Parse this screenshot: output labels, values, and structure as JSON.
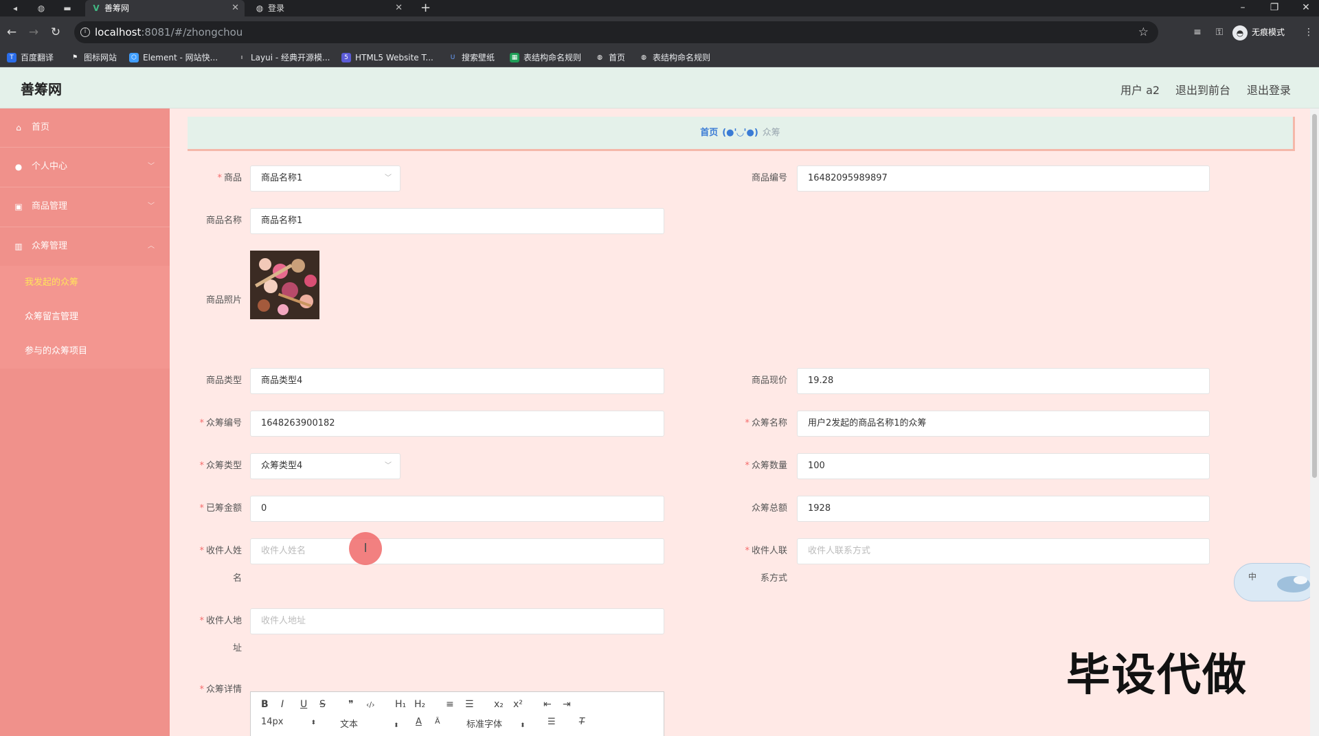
{
  "browser": {
    "tabs": [
      {
        "title": "善筹网",
        "active": true
      },
      {
        "title": "登录",
        "active": false
      }
    ],
    "url_host": "localhost",
    "url_path": ":8081/#/zhongchou",
    "incognito_label": "无痕模式",
    "bookmarks": [
      "百度翻译",
      "图标网站",
      "Element - 网站快...",
      "Layui - 经典开源模...",
      "HTML5 Website T...",
      "搜索壁纸",
      "表结构命名规则",
      "首页",
      "表结构命名规则"
    ]
  },
  "header": {
    "title": "善筹网",
    "user": "用户 a2",
    "back_front": "退出到前台",
    "logout": "退出登录"
  },
  "sidebar": {
    "items": [
      {
        "label": "首页",
        "icon": "home-icon"
      },
      {
        "label": "个人中心",
        "icon": "user-icon"
      },
      {
        "label": "商品管理",
        "icon": "grid-icon"
      },
      {
        "label": "众筹管理",
        "icon": "chart-icon"
      }
    ],
    "subitems": [
      "我发起的众筹",
      "众筹留言管理",
      "参与的众筹项目"
    ]
  },
  "breadcrumb": {
    "home": "首页",
    "sep": "(●'◡'●)",
    "current": "众筹"
  },
  "form": {
    "goods": {
      "label": "商品",
      "value": "商品名称1"
    },
    "goods_no": {
      "label": "商品编号",
      "value": "16482095989897"
    },
    "goods_name": {
      "label": "商品名称",
      "value": "商品名称1"
    },
    "goods_photo": {
      "label": "商品照片"
    },
    "goods_type": {
      "label": "商品类型",
      "value": "商品类型4"
    },
    "price": {
      "label": "商品现价",
      "value": "19.28"
    },
    "cf_no": {
      "label": "众筹编号",
      "value": "1648263900182"
    },
    "cf_name": {
      "label": "众筹名称",
      "value": "用户2发起的商品名称1的众筹"
    },
    "cf_type": {
      "label": "众筹类型",
      "value": "众筹类型4"
    },
    "cf_qty": {
      "label": "众筹数量",
      "value": "100"
    },
    "raised": {
      "label": "已筹金额",
      "value": "0"
    },
    "total": {
      "label": "众筹总额",
      "value": "1928"
    },
    "recv_name": {
      "label_1": "收件人姓",
      "label_2": "名",
      "placeholder": "收件人姓名"
    },
    "recv_contact": {
      "label_1": "收件人联",
      "label_2": "系方式",
      "placeholder": "收件人联系方式"
    },
    "recv_addr": {
      "label_1": "收件人地",
      "label_2": "址",
      "placeholder": "收件人地址"
    },
    "detail": {
      "label": "众筹详情"
    }
  },
  "editor": {
    "buttons": [
      "B",
      "I",
      "U",
      "S",
      "❞",
      "‹/›",
      "H₁",
      "H₂",
      "≡",
      "☰",
      "x₂",
      "x²",
      "⇤",
      "⇥"
    ],
    "font_size": "14px",
    "text_style": "文本",
    "font_family": "标准字体"
  },
  "widget": {
    "text": "中"
  },
  "watermark": "毕设代做"
}
